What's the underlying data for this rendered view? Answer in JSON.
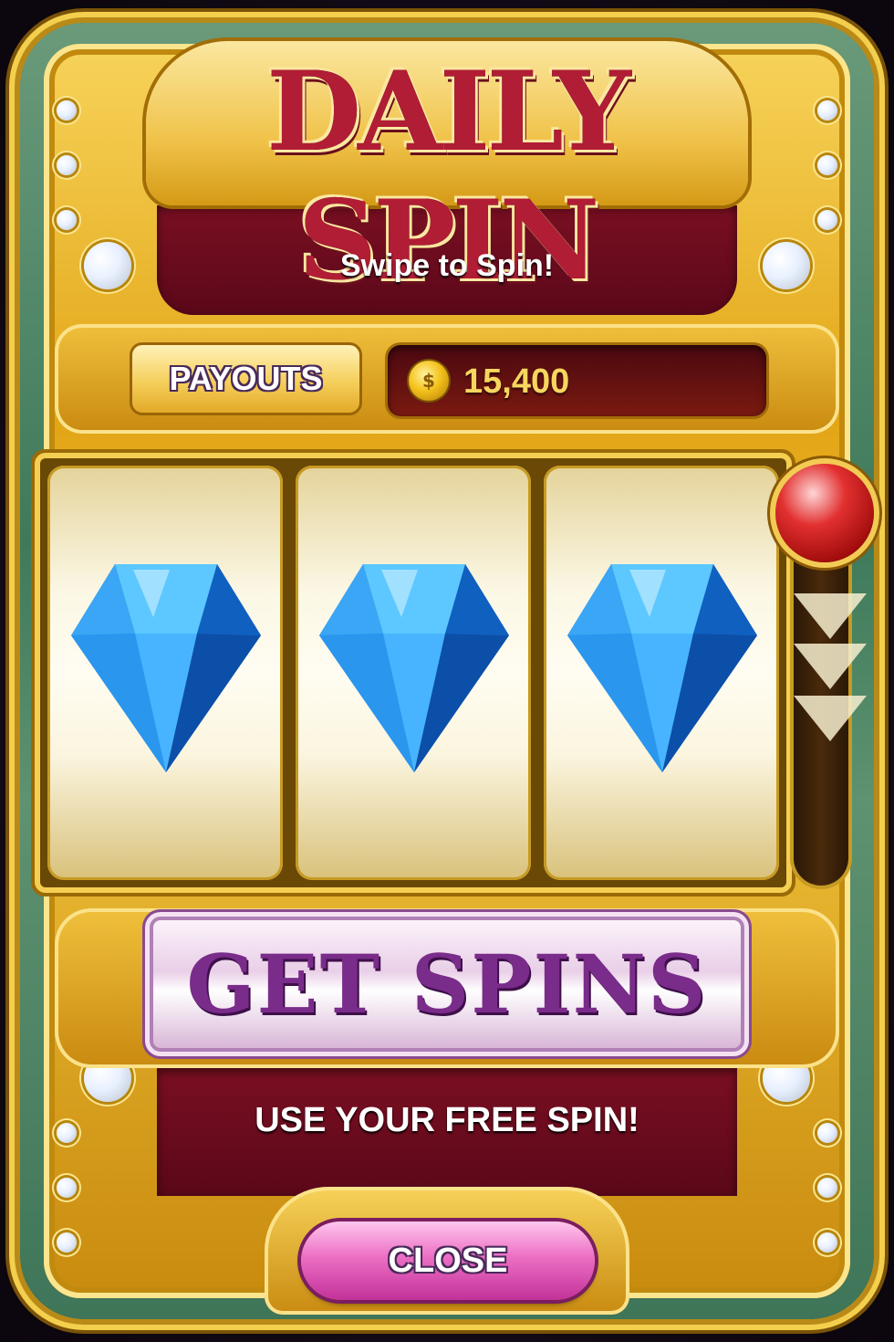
{
  "title": "DAILY SPIN",
  "subtitle": "Swipe to Spin!",
  "payouts_label": "PAYOUTS",
  "coins": {
    "icon": "coin-icon",
    "value": "15,400"
  },
  "reels": [
    {
      "symbol": "blue-diamond-icon"
    },
    {
      "symbol": "blue-diamond-icon"
    },
    {
      "symbol": "blue-diamond-icon"
    }
  ],
  "get_spins_label": "GET SPINS",
  "free_spin_text": "USE YOUR FREE SPIN!",
  "close_label": "CLOSE",
  "colors": {
    "gold": "#e2a516",
    "maroon": "#6a0a1c",
    "gem": "#1e8ef0",
    "lever": "#e23030",
    "close": "#ec6fc4"
  }
}
